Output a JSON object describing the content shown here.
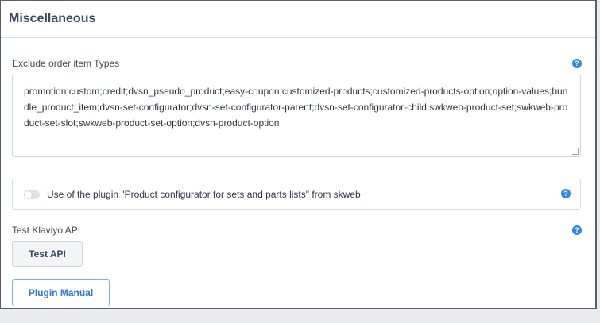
{
  "card": {
    "title": "Miscellaneous"
  },
  "exclude": {
    "label": "Exclude order item Types",
    "value": "promotion;custom;credit;dvsn_pseudo_product;easy-coupon;customized-products;customized-products-option;option-values;bundle_product_item;dvsn-set-configurator;dvsn-set-configurator-parent;dvsn-set-configurator-child;swkweb-product-set;swkweb-product-set-slot;swkweb-product-set-option;dvsn-product-option"
  },
  "plugin_toggle": {
    "label": "Use of the plugin \"Product configurator for sets and parts lists\" from skweb",
    "enabled": false
  },
  "klaviyo": {
    "label": "Test Klaviyo API",
    "button": "Test API"
  },
  "manual": {
    "button": "Plugin Manual"
  },
  "icons": {
    "help": "?"
  },
  "colors": {
    "accent": "#2f87e8"
  }
}
